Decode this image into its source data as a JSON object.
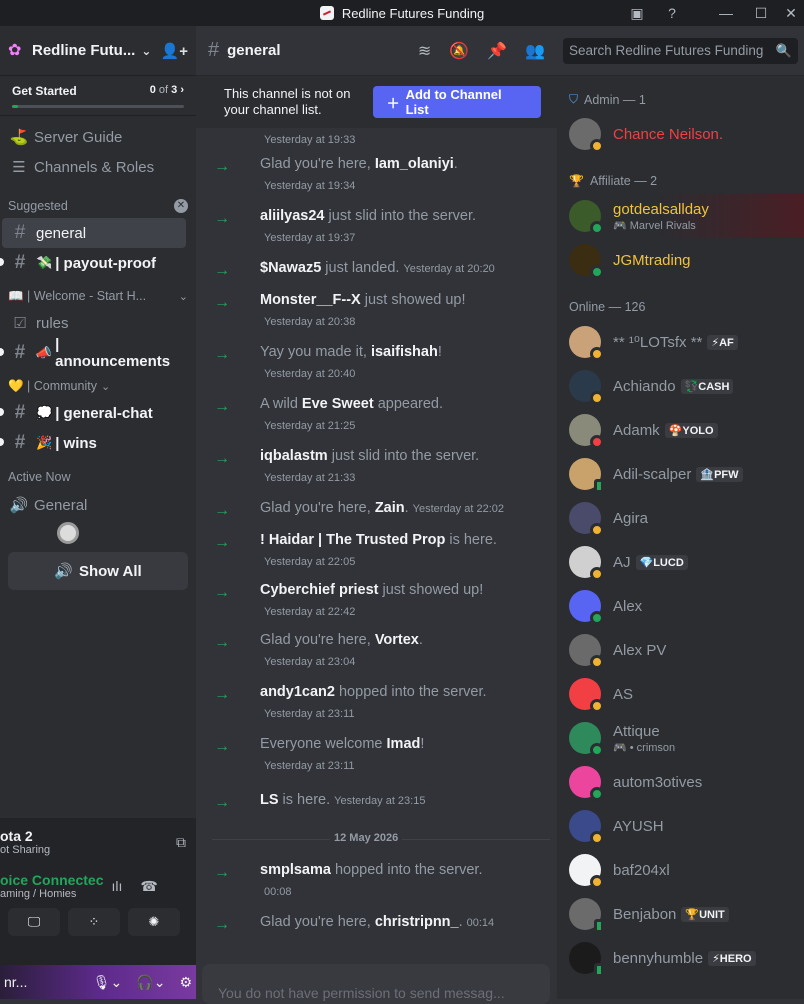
{
  "window": {
    "title": "Redline Futures Funding"
  },
  "sidebar": {
    "server_name": "Redline Futu...",
    "get_started": {
      "label": "Get Started",
      "done": "0",
      "of": "of",
      "total": "3",
      "progress": 0
    },
    "nav": [
      {
        "label": "Server Guide"
      },
      {
        "label": "Channels & Roles"
      }
    ],
    "suggested_label": "Suggested",
    "channels_suggested": [
      {
        "name": "general"
      },
      {
        "emoji": "💸",
        "name": "| payout-proof"
      }
    ],
    "category_welcome": "📖 | Welcome - Start H...",
    "channels_welcome": [
      {
        "name": "rules"
      },
      {
        "emoji": "📣",
        "name": "| announcements"
      }
    ],
    "category_community": "💛 | Community",
    "channels_community": [
      {
        "emoji": "💭",
        "name": "| general-chat"
      },
      {
        "emoji": "🎉",
        "name": "| wins"
      }
    ],
    "active_now": "Active Now",
    "voice_channel": "General",
    "show_all": "Show All"
  },
  "voice_panel": {
    "game_title": "ota 2",
    "game_sub": "ot Sharing",
    "status": "oice Connectec",
    "status_sub": "aming / Homies",
    "user_name": "nr..."
  },
  "chat_header": {
    "channel": "general"
  },
  "search": {
    "placeholder": "Search Redline Futures Funding"
  },
  "notice": {
    "text": "This channel is not on your channel list.",
    "button": "Add to Channel List"
  },
  "messages": [
    {
      "pre": "",
      "user": "",
      "post": "",
      "ts": "Yesterday at 19:33",
      "inline": false
    },
    {
      "pre": "Glad you're here, ",
      "user": "Iam_olaniyi",
      "post": ".",
      "ts": "Yesterday at 19:34",
      "inline": false
    },
    {
      "pre": "",
      "user": "aliilyas24",
      "post": " just slid into the server.",
      "ts": "Yesterday at 19:37",
      "inline": false
    },
    {
      "pre": "",
      "user": "$Nawaz5",
      "post": " just landed.",
      "ts": "Yesterday at 20:20",
      "inline": true
    },
    {
      "pre": "",
      "user": "Monster__F--X",
      "post": " just showed up!",
      "ts": "Yesterday at 20:38",
      "inline": false
    },
    {
      "pre": "Yay you made it, ",
      "user": "isaifishah",
      "post": "!",
      "ts": "Yesterday at 20:40",
      "inline": false
    },
    {
      "pre": "A wild ",
      "user": "Eve Sweet",
      "post": " appeared.",
      "ts": "Yesterday at 21:25",
      "inline": false
    },
    {
      "pre": "",
      "user": "iqbalastm",
      "post": " just slid into the server.",
      "ts": "Yesterday at 21:33",
      "inline": false
    },
    {
      "pre": "Glad you're here, ",
      "user": "Zain",
      "post": ".",
      "ts": "Yesterday at 22:02",
      "inline": true
    },
    {
      "pre": "",
      "user": "! Haidar | The Trusted Prop",
      "post": " is here.",
      "ts": "Yesterday at 22:05",
      "inline": false
    },
    {
      "pre": "",
      "user": "Cyberchief priest",
      "post": " just showed up!",
      "ts": "Yesterday at 22:42",
      "inline": false
    },
    {
      "pre": "Glad you're here, ",
      "user": "Vortex",
      "post": ".",
      "ts": "Yesterday at 23:04",
      "inline": false
    },
    {
      "pre": "",
      "user": "andy1can2",
      "post": " hopped into the server.",
      "ts": "Yesterday at 23:11",
      "inline": false
    },
    {
      "pre": "Everyone welcome ",
      "user": "Imad",
      "post": "!",
      "ts": "Yesterday at 23:11",
      "inline": false
    },
    {
      "pre": "",
      "user": "LS",
      "post": " is here.",
      "ts": "Yesterday at 23:15",
      "inline": true
    },
    {
      "pre": "",
      "user": "smplsama",
      "post": " hopped into the server.",
      "ts": "00:08",
      "inline": false
    },
    {
      "pre": "Glad you're here, ",
      "user": "christripnn_",
      "post": ".",
      "ts": "00:14",
      "inline": true
    }
  ],
  "date_divider": "12 May 2026",
  "composer": {
    "placeholder": "You do not have permission to send messag..."
  },
  "members": {
    "admin_group": "Admin — 1",
    "affiliate_group": "Affiliate — 2",
    "online_group": "Online — 126",
    "admin": [
      {
        "name": "Chance Neilson.",
        "status": "idle"
      }
    ],
    "affiliate": [
      {
        "name": "gotdealsallday",
        "sub": "🎮 Marvel Rivals",
        "status": "online"
      },
      {
        "name": "JGMtrading",
        "sub": "",
        "status": "online"
      }
    ],
    "online": [
      {
        "name": "** ¹⁰LOTsfx **",
        "tag": "⚡AF",
        "sub": "",
        "status": "idle"
      },
      {
        "name": "Achiando",
        "tag": "💱CASH",
        "sub": "",
        "status": "idle"
      },
      {
        "name": "Adamk",
        "tag": "🍄YOLO",
        "sub": "",
        "status": "dnd"
      },
      {
        "name": "Adil-scalper",
        "tag": "🏦PFW",
        "sub": "",
        "status": "mobile"
      },
      {
        "name": "Agira",
        "tag": "",
        "sub": "",
        "status": "idle"
      },
      {
        "name": "AJ",
        "tag": "💎LUCD",
        "sub": "",
        "status": "idle"
      },
      {
        "name": "Alex",
        "tag": "",
        "sub": "",
        "status": "online"
      },
      {
        "name": "Alex PV",
        "tag": "",
        "sub": "",
        "status": "idle"
      },
      {
        "name": "AS",
        "tag": "",
        "sub": "",
        "status": "idle"
      },
      {
        "name": "Attique",
        "tag": "",
        "sub": "🎮 • crimson",
        "status": "online"
      },
      {
        "name": "autom3otives",
        "tag": "",
        "sub": "",
        "status": "online"
      },
      {
        "name": "AYUSH",
        "tag": "",
        "sub": "",
        "status": "idle"
      },
      {
        "name": "baf204xl",
        "tag": "",
        "sub": "",
        "status": "idle"
      },
      {
        "name": "Benjabon",
        "tag": "🏆UNIT",
        "sub": "",
        "status": "mobile"
      },
      {
        "name": "bennyhumble",
        "tag": "⚡HERO",
        "sub": "",
        "status": "mobile"
      }
    ]
  },
  "colors": {
    "accent": "#5865f2",
    "online": "#23a55a",
    "idle": "#f0b232",
    "dnd": "#f23f43",
    "admin": "#f23f43",
    "affiliate": "#f0c43a"
  }
}
